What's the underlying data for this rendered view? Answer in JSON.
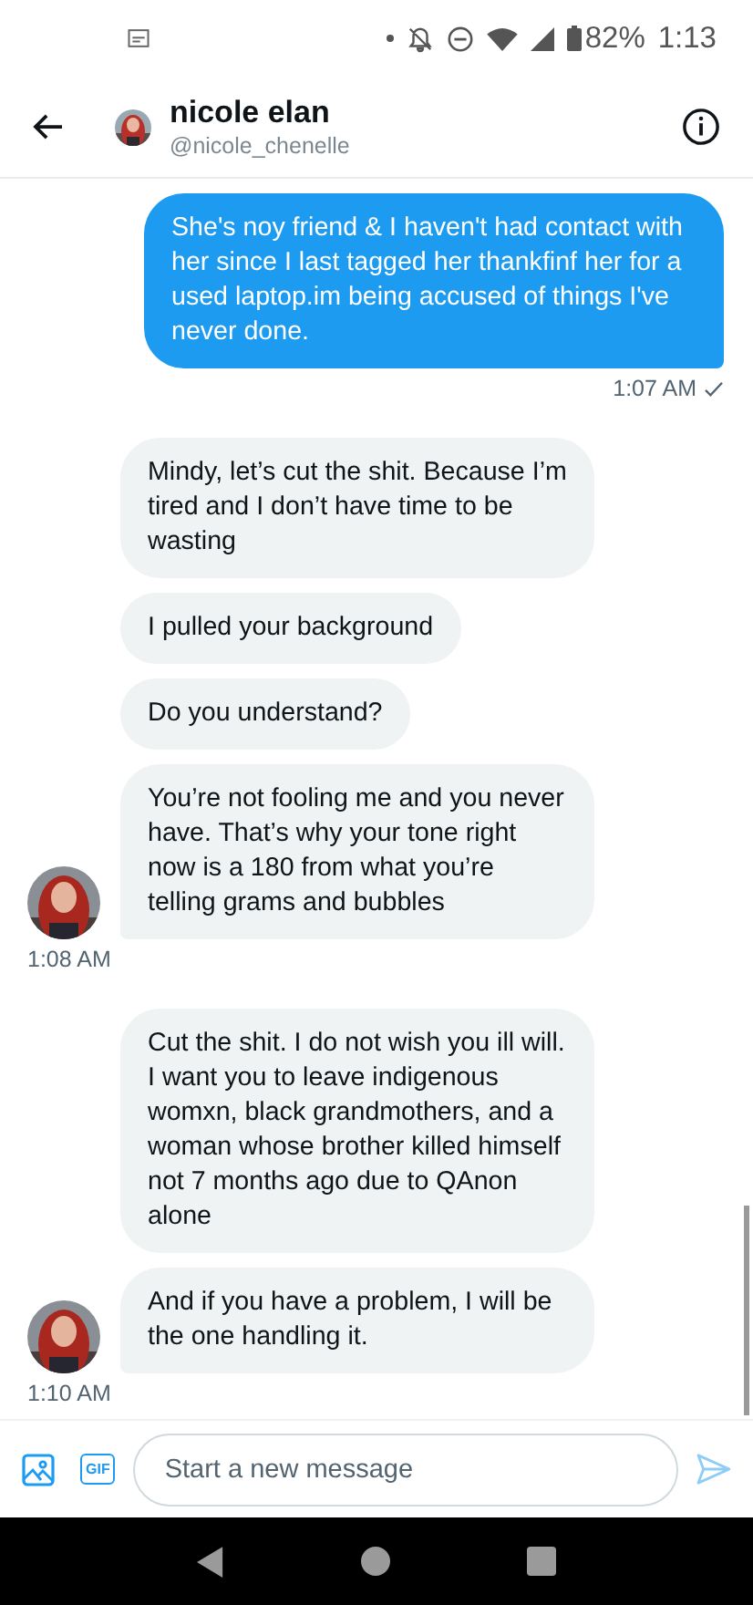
{
  "status_bar": {
    "battery": "82%",
    "time": "1:13"
  },
  "header": {
    "name": "nicole elan",
    "handle": "@nicole_chenelle"
  },
  "conversation": [
    {
      "kind": "sent",
      "bubbles": [
        "She's noy friend & I haven't had contact with her since I last tagged her thankfinf her for a used laptop.im being accused of things I've never done."
      ],
      "time": "1:07 AM",
      "read": true
    },
    {
      "kind": "received",
      "bubbles": [
        "Mindy, let’s cut the shit. Because I’m tired and I don’t have time to be wasting",
        "I pulled your background",
        "Do you understand?",
        "You’re not fooling me and you never have. That’s why your tone right now is a 180 from what you’re telling grams and bubbles"
      ],
      "time": "1:08 AM",
      "read": false
    },
    {
      "kind": "received",
      "bubbles": [
        "Cut the shit. I do not wish you ill will. I want you to leave indigenous womxn, black grandmothers, and a woman whose brother killed himself not 7 months ago due to QAnon alone",
        "And if you have a problem, I will be the one handling it."
      ],
      "time": "1:10 AM",
      "read": false
    }
  ],
  "composer": {
    "gif_label": "GIF",
    "placeholder": "Start a new message"
  }
}
